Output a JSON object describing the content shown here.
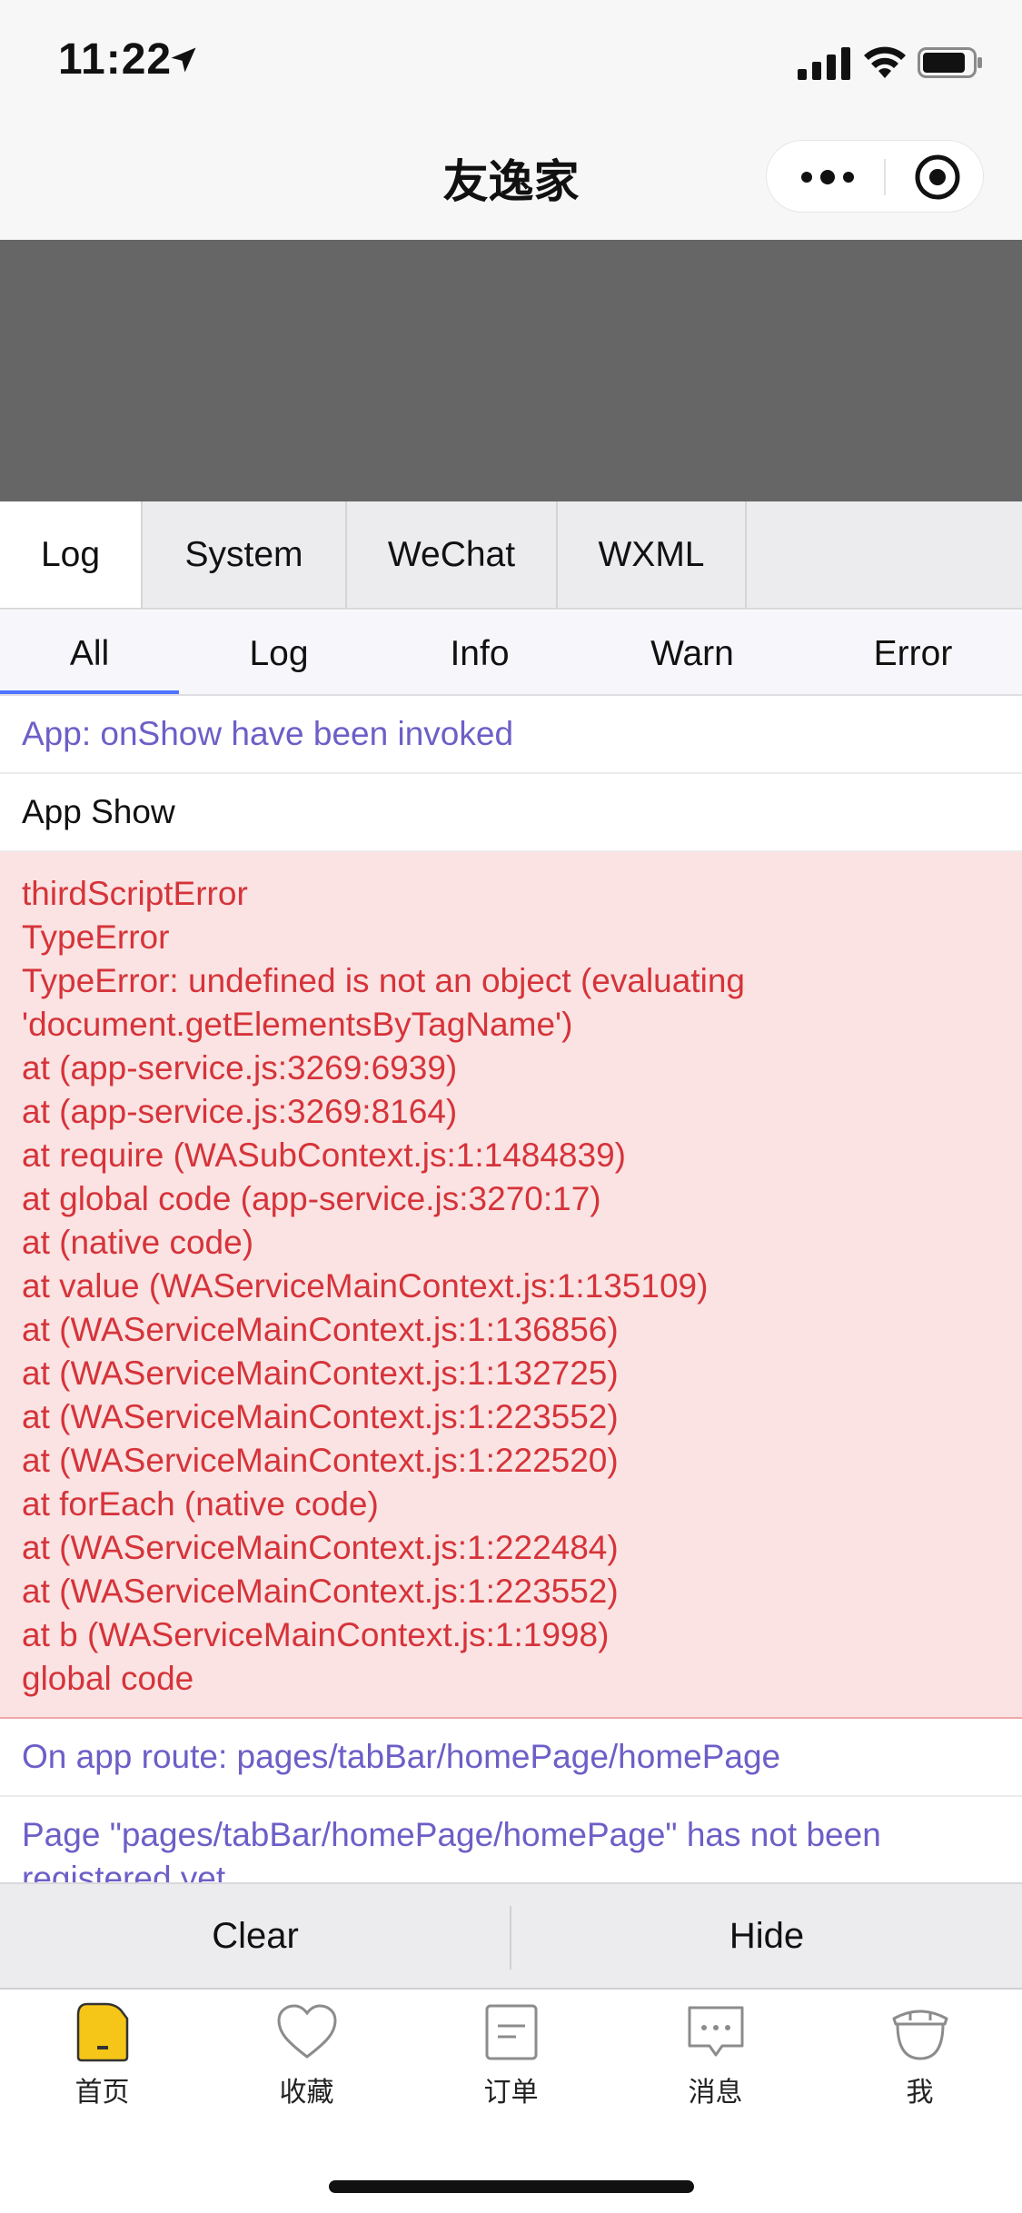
{
  "status_bar": {
    "time": "11:22"
  },
  "nav": {
    "title": "友逸家"
  },
  "tabs": [
    {
      "label": "Log",
      "active": true
    },
    {
      "label": "System",
      "active": false
    },
    {
      "label": "WeChat",
      "active": false
    },
    {
      "label": "WXML",
      "active": false
    }
  ],
  "filters": [
    {
      "label": "All",
      "active": true
    },
    {
      "label": "Log",
      "active": false
    },
    {
      "label": "Info",
      "active": false
    },
    {
      "label": "Warn",
      "active": false
    },
    {
      "label": "Error",
      "active": false
    }
  ],
  "logs": {
    "info_1": "App: onShow have been invoked",
    "plain_1": "App Show",
    "error_lines": [
      "thirdScriptError",
      "TypeError",
      "TypeError: undefined is not an object (evaluating",
      "'document.getElementsByTagName')",
      "at (app-service.js:3269:6939)",
      "at (app-service.js:3269:8164)",
      "at require (WASubContext.js:1:1484839)",
      "at global code (app-service.js:3270:17)",
      "at (native code)",
      "at value (WAServiceMainContext.js:1:135109)",
      "at (WAServiceMainContext.js:1:136856)",
      "at (WAServiceMainContext.js:1:132725)",
      "at (WAServiceMainContext.js:1:223552)",
      "at (WAServiceMainContext.js:1:222520)",
      "at forEach (native code)",
      "at (WAServiceMainContext.js:1:222484)",
      "at (WAServiceMainContext.js:1:223552)",
      "at b (WAServiceMainContext.js:1:1998)",
      "global code"
    ],
    "info_2": "On app route: pages/tabBar/homePage/homePage",
    "info_3": "Page \"pages/tabBar/homePage/homePage\" has not been registered yet."
  },
  "actions": {
    "clear_label": "Clear",
    "hide_label": "Hide"
  },
  "tabbar": [
    {
      "label": "首页",
      "icon": "home-icon",
      "active": true
    },
    {
      "label": "收藏",
      "icon": "heart-icon",
      "active": false
    },
    {
      "label": "订单",
      "icon": "order-icon",
      "active": false
    },
    {
      "label": "消息",
      "icon": "message-icon",
      "active": false
    },
    {
      "label": "我",
      "icon": "profile-icon",
      "active": false
    }
  ],
  "colors": {
    "info_text": "#6c5fc7",
    "error_text": "#d6333a",
    "error_bg": "#fae3e2",
    "active_filter_underline": "#4f74ff",
    "home_active": "#f5c518"
  }
}
